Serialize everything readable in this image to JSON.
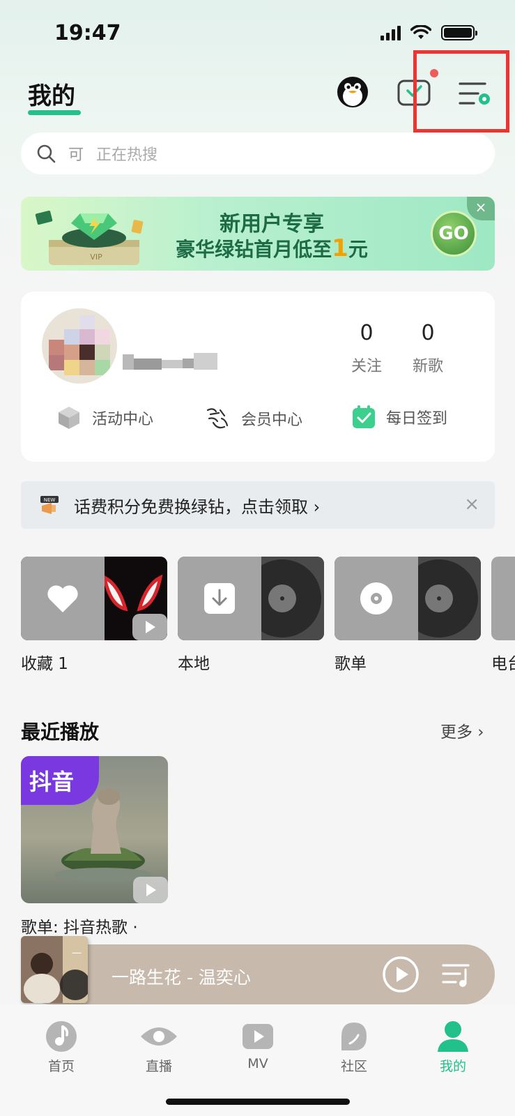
{
  "status_bar": {
    "time": "19:47"
  },
  "header": {
    "title": "我的"
  },
  "search": {
    "prefix": "可",
    "placeholder": "正在热搜"
  },
  "banner": {
    "line1": "新用户专享",
    "line2_main": "豪华绿钻首月低至",
    "line2_accent": "1",
    "line2_suffix": "元",
    "go_label": "GO",
    "close_label": "×"
  },
  "profile": {
    "stats": [
      {
        "value": "0",
        "label": "关注"
      },
      {
        "value": "0",
        "label": "新歌"
      }
    ],
    "quick_links": [
      {
        "label": "活动中心",
        "icon": "cube-icon"
      },
      {
        "label": "会员中心",
        "icon": "calligraphy-logo-icon"
      },
      {
        "label": "每日签到",
        "icon": "calendar-check-icon"
      }
    ]
  },
  "notice": {
    "text": "话费积分免费换绿钻，点击领取 ›",
    "close_label": "×"
  },
  "shelf": [
    {
      "label": "收藏 1"
    },
    {
      "label": "本地"
    },
    {
      "label": "歌单"
    },
    {
      "label": "电台"
    }
  ],
  "recent": {
    "title": "最近播放",
    "more": "更多 ›",
    "cover_tag": "抖音",
    "caption": "歌单: 抖音热歌 ·"
  },
  "player": {
    "track": "一路生花 - 温奕心"
  },
  "nav": [
    {
      "label": "首页"
    },
    {
      "label": "直播"
    },
    {
      "label": "MV"
    },
    {
      "label": "社区"
    },
    {
      "label": "我的"
    }
  ],
  "colors": {
    "accent": "#22c08a",
    "highlight": "#ee3333",
    "player_bg": "#c7b9ab"
  }
}
